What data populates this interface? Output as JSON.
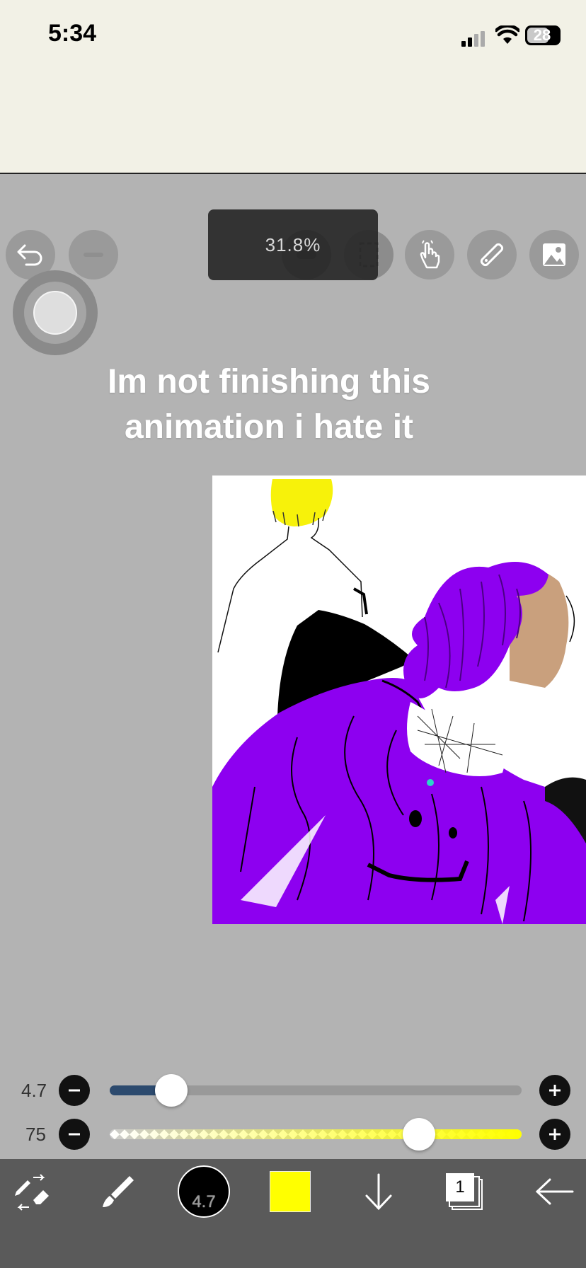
{
  "status_bar": {
    "time": "5:34",
    "battery": "28"
  },
  "top_tools": {
    "zoom_level": "31.8%",
    "icons": [
      "undo-icon",
      "redo-icon",
      "toggle-icon",
      "frame-icon",
      "hand-icon",
      "ruler-icon",
      "image-icon"
    ]
  },
  "overlay_caption": {
    "line1": "Im not finishing this",
    "line2": "animation i hate it"
  },
  "sliders": {
    "brush_size": {
      "label": "4.7",
      "fraction": 0.15
    },
    "opacity": {
      "label": "75",
      "fraction": 0.75
    }
  },
  "bottom_toolbar": {
    "brush_size_value": "4.7",
    "current_color": "#ffff00",
    "layer_count": "1"
  },
  "colors": {
    "status_bg": "#f2f1e6",
    "canvas_bg": "#b3b3b3",
    "toolbar_bg": "#5a5a5a",
    "accent_track": "#2c4a6e",
    "opacity_color": "#ffff00"
  }
}
